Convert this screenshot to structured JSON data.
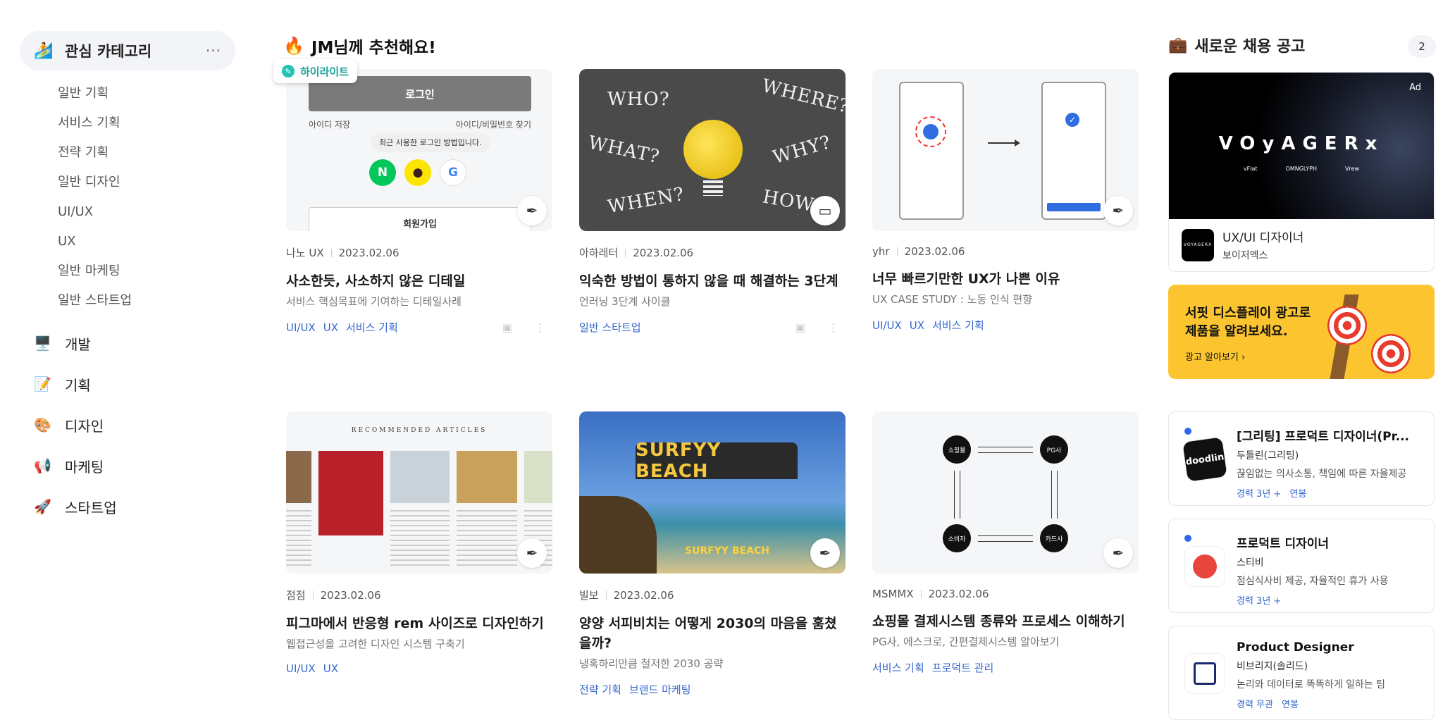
{
  "sidebar": {
    "header": {
      "emoji": "🏄",
      "title": "관심 카테고리",
      "more": "···"
    },
    "sub_items": [
      "일반 기획",
      "서비스 기획",
      "전략 기획",
      "일반 디자인",
      "UI/UX",
      "UX",
      "일반 마케팅",
      "일반 스타트업"
    ],
    "categories": [
      {
        "emoji": "🖥️",
        "label": "개발"
      },
      {
        "emoji": "📝",
        "label": "기획"
      },
      {
        "emoji": "🎨",
        "label": "디자인"
      },
      {
        "emoji": "📢",
        "label": "마케팅"
      },
      {
        "emoji": "🚀",
        "label": "스타트업"
      }
    ]
  },
  "recommend": {
    "emoji": "🔥",
    "title": "JM님께 추천해요!",
    "highlight_badge": "하이라이트",
    "cards": [
      {
        "author": "나노 UX",
        "date": "2023.02.06",
        "title": "사소한듯, 사소하지 않은 디테일",
        "subtitle": "서비스 핵심목표에 기여하는 디테일사례",
        "tags": [
          "UI/UX",
          "UX",
          "서비스 기획"
        ],
        "thumb": {
          "login": "로그인",
          "save_id": "아이디 저장",
          "find": "아이디/비밀번호 찾기",
          "bubble": "최근 사용한 로그인 방법입니다.",
          "signup": "회원가입"
        }
      },
      {
        "author": "아하레터",
        "date": "2023.02.06",
        "title": "익숙한 방법이 통하지 않을 때 해결하는 3단계",
        "subtitle": "언러닝 3단계 사이클",
        "tags": [
          "일반 스타트업"
        ],
        "thumb": {
          "words": [
            "WHO?",
            "WHERE?",
            "WHAT?",
            "WHY?",
            "WHEN?",
            "HOW?"
          ]
        }
      },
      {
        "author": "yhr",
        "date": "2023.02.06",
        "title": "너무 빠르기만한 UX가 나쁜 이유",
        "subtitle": "UX CASE STUDY : 노동 인식 편향",
        "tags": [
          "UI/UX",
          "UX",
          "서비스 기획"
        ]
      },
      {
        "author": "점점",
        "date": "2023.02.06",
        "title": "피그마에서 반응형 rem 사이즈로 디자인하기",
        "subtitle": "웹접근성을 고려한 디자인 시스템 구축기",
        "tags": [
          "UI/UX",
          "UX"
        ],
        "thumb": {
          "heading": "RECOMMENDED ARTICLES"
        }
      },
      {
        "author": "빌보",
        "date": "2023.02.06",
        "title": "양양 서피비치는 어떻게 2030의 마음을 훔쳤을까?",
        "subtitle": "냉혹하리만큼 철저한 2030 공략",
        "tags": [
          "전략 기획",
          "브랜드 마케팅"
        ],
        "thumb": {
          "sign": "SURFYY BEACH",
          "sub": "SURFYY BEACH"
        }
      },
      {
        "author": "MSMMX",
        "date": "2023.02.06",
        "title": "쇼핑몰 결제시스템 종류와 프로세스 이해하기",
        "subtitle": "PG사, 에스크로, 간편결제시스템 알아보기",
        "tags": [
          "서비스 기획",
          "프로덕트 관리"
        ],
        "thumb": {
          "n1": "쇼핑몰",
          "n2": "PG사",
          "n3": "소비자",
          "n4": "카드사"
        }
      }
    ]
  },
  "jobs": {
    "emoji": "💼",
    "title": "새로운 채용 공고",
    "count": "2",
    "ad": {
      "tag": "Ad",
      "brand": "VOyAGERx",
      "brand_subs": [
        "vFlat",
        "OMNGLYPH",
        "Vrew"
      ],
      "logo_text": "VOYAGERX",
      "title": "UX/UI 디자이너",
      "company": "보이저엑스"
    },
    "promo": {
      "line1": "서핏 디스플레이 광고로",
      "line2": "제품을 알려보세요.",
      "link": "광고 알아보기 ›"
    },
    "items": [
      {
        "logo": "doodlin",
        "title": "[그리팅] 프로덕트 디자이너(Pr...",
        "company": "두들린(그리팅)",
        "desc": "끊임없는 의사소통, 책임에 따른 자율제공",
        "tags": [
          "경력 3년 +",
          "연봉"
        ]
      },
      {
        "logo": "stibee",
        "title": "프로덕트 디자이너",
        "company": "스티비",
        "desc": "점심식사비 제공, 자율적인 휴가 사용",
        "tags": [
          "경력 3년 +"
        ]
      },
      {
        "logo": "vibrary",
        "title": "Product Designer",
        "company": "비브리지(솔리드)",
        "desc": "논리와 데이터로 똑똑하게 일하는 팀",
        "tags": [
          "경력 무관",
          "연봉"
        ]
      }
    ]
  }
}
